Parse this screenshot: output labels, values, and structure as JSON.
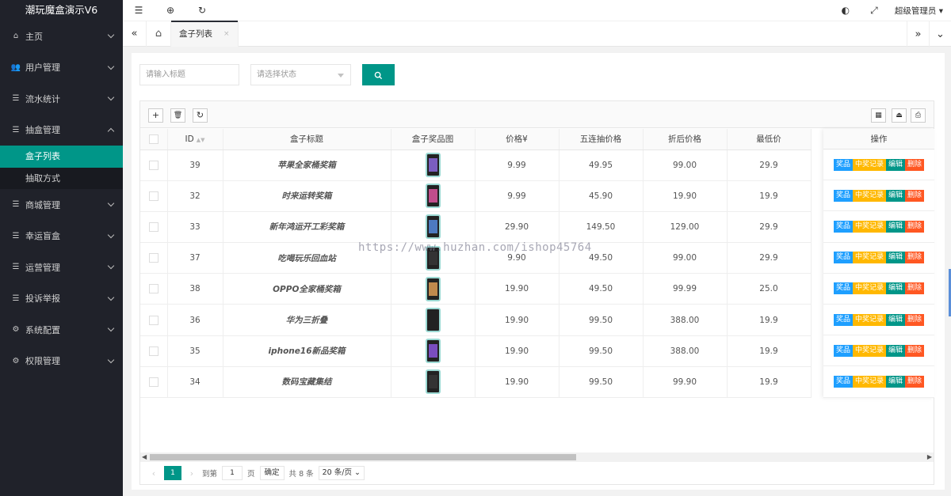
{
  "app": {
    "title": "潮玩魔盒演示V6"
  },
  "sidebar": {
    "items": [
      {
        "label": "主页",
        "icon": "home-icon",
        "glyph": "⌂"
      },
      {
        "label": "用户管理",
        "icon": "users-icon",
        "glyph": "👥"
      },
      {
        "label": "流水统计",
        "icon": "list-icon",
        "glyph": "☰"
      },
      {
        "label": "抽盒管理",
        "icon": "list-icon",
        "glyph": "☰"
      },
      {
        "label": "商城管理",
        "icon": "list-icon",
        "glyph": "☰"
      },
      {
        "label": "幸运盲盒",
        "icon": "list-icon",
        "glyph": "☰"
      },
      {
        "label": "运营管理",
        "icon": "list-icon",
        "glyph": "☰"
      },
      {
        "label": "投诉举报",
        "icon": "list-icon",
        "glyph": "☰"
      },
      {
        "label": "系统配置",
        "icon": "settings-icon",
        "glyph": "⚙"
      },
      {
        "label": "权限管理",
        "icon": "gear-icon",
        "glyph": "⚙"
      }
    ],
    "sub_items": [
      {
        "label": "盒子列表",
        "active": true
      },
      {
        "label": "抽取方式",
        "active": false
      }
    ]
  },
  "topbar": {
    "admin_label": "超级管理员"
  },
  "tabs": {
    "active_label": "盒子列表",
    "close": "×"
  },
  "search": {
    "title_placeholder": "请输入标题",
    "status_placeholder": "请选择状态"
  },
  "table": {
    "columns": [
      "ID",
      "盒子标题",
      "盒子奖品图",
      "价格¥",
      "五连抽价格",
      "折后价格",
      "最低价",
      "操作"
    ],
    "rows": [
      {
        "id": "39",
        "title": "苹果全家桶奖箱",
        "price": "9.99",
        "five": "49.95",
        "discount": "99.00",
        "min": "29.9"
      },
      {
        "id": "32",
        "title": "时来运转奖箱",
        "price": "9.99",
        "five": "45.90",
        "discount": "19.90",
        "min": "19.9"
      },
      {
        "id": "33",
        "title": "新年鸿运开工彩奖箱",
        "price": "29.90",
        "five": "149.50",
        "discount": "129.00",
        "min": "29.9"
      },
      {
        "id": "37",
        "title": "吃喝玩乐回血站",
        "price": "9.90",
        "five": "49.50",
        "discount": "99.00",
        "min": "29.9"
      },
      {
        "id": "38",
        "title": "OPPO全家桶奖箱",
        "price": "19.90",
        "five": "49.50",
        "discount": "99.99",
        "min": "25.0"
      },
      {
        "id": "36",
        "title": "华为三折叠",
        "price": "19.90",
        "five": "99.50",
        "discount": "388.00",
        "min": "19.9"
      },
      {
        "id": "35",
        "title": "iphone16新品奖箱",
        "price": "19.90",
        "five": "99.50",
        "discount": "388.00",
        "min": "19.9"
      },
      {
        "id": "34",
        "title": "数码宝藏集结",
        "price": "19.90",
        "five": "99.50",
        "discount": "99.90",
        "min": "19.9"
      }
    ],
    "actions": {
      "prize": "奖品",
      "records": "中奖记录",
      "edit": "编辑",
      "delete": "删除"
    }
  },
  "pager": {
    "current": "1",
    "goto_label": "到第",
    "goto_value": "1",
    "page_unit": "页",
    "confirm": "确定",
    "total": "共 8 条",
    "page_size": "20 条/页"
  },
  "watermark": "https://www.huzhan.com/ishop45764",
  "colors": {
    "sidebar": "#20222a",
    "accent": "#009688",
    "blue": "#1e9fff",
    "orange": "#ffb800",
    "red": "#ff5722"
  }
}
